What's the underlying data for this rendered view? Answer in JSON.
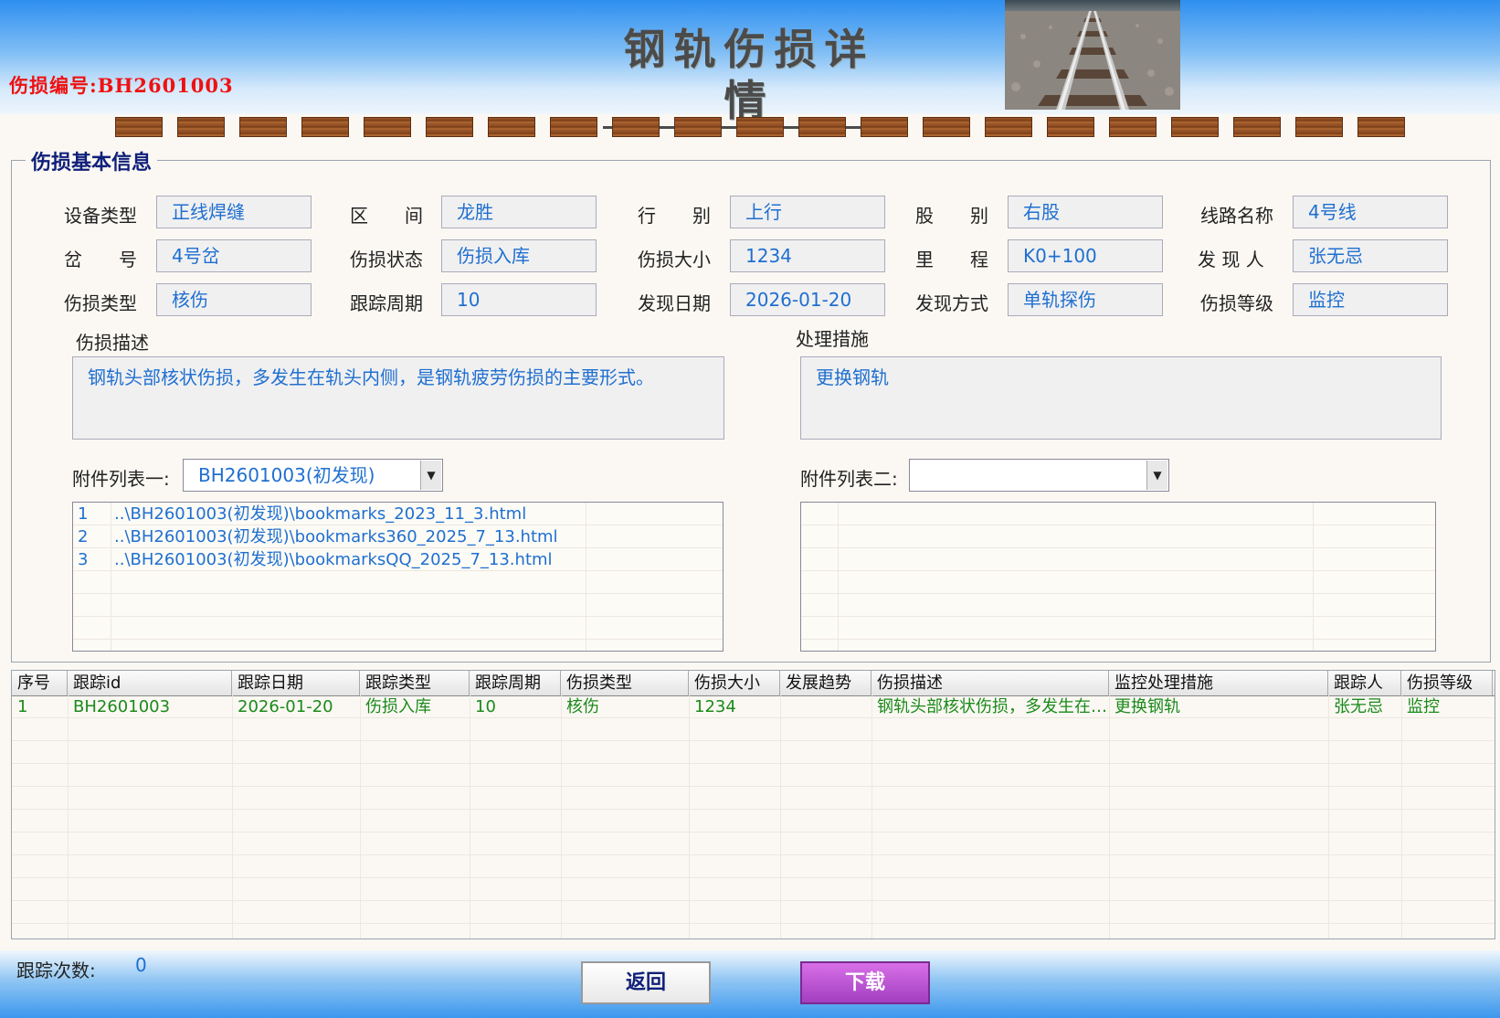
{
  "header": {
    "damage_no_label": "伤损编号:",
    "damage_no": "BH2601003",
    "title": "钢轨伤损详情"
  },
  "info": {
    "section_title": "伤损基本信息",
    "fields": [
      {
        "label": "设备类型",
        "value": "正线焊缝"
      },
      {
        "label": "区　　间",
        "value": "龙胜"
      },
      {
        "label": "行　　别",
        "value": "上行"
      },
      {
        "label": "股　　别",
        "value": "右股"
      },
      {
        "label": "线路名称",
        "value": "4号线"
      },
      {
        "label": "岔　　号",
        "value": "4号岔"
      },
      {
        "label": "伤损状态",
        "value": "伤损入库"
      },
      {
        "label": "伤损大小",
        "value": "1234"
      },
      {
        "label": "里　　程",
        "value": "K0+100"
      },
      {
        "label": "发 现 人",
        "value": "张无忌"
      },
      {
        "label": "伤损类型",
        "value": "核伤"
      },
      {
        "label": "跟踪周期",
        "value": "10"
      },
      {
        "label": "发现日期",
        "value": "2026-01-20"
      },
      {
        "label": "发现方式",
        "value": "单轨探伤"
      },
      {
        "label": "伤损等级",
        "value": "监控"
      }
    ],
    "description_label": "伤损描述",
    "description": "钢轨头部核状伤损，多发生在轨头内侧，是钢轨疲劳伤损的主要形式。",
    "measures_label": "处理措施",
    "measures": "更换钢轨"
  },
  "attachments": {
    "list1_label": "附件列表一:",
    "list1_selected": "BH2601003(初发现)",
    "list1_items": [
      {
        "no": "1",
        "path": "..\\BH2601003(初发现)\\bookmarks_2023_11_3.html"
      },
      {
        "no": "2",
        "path": "..\\BH2601003(初发现)\\bookmarks360_2025_7_13.html"
      },
      {
        "no": "3",
        "path": "..\\BH2601003(初发现)\\bookmarksQQ_2025_7_13.html"
      }
    ],
    "list2_label": "附件列表二:",
    "list2_selected": ""
  },
  "grid": {
    "columns": [
      "序号",
      "跟踪id",
      "跟踪日期",
      "跟踪类型",
      "跟踪周期",
      "伤损类型",
      "伤损大小",
      "发展趋势",
      "伤损描述",
      "监控处理措施",
      "跟踪人",
      "伤损等级"
    ],
    "rows": [
      [
        "1",
        "BH2601003",
        "2026-01-20",
        "伤损入库",
        "10",
        "核伤",
        "1234",
        "",
        "钢轨头部核状伤损，多发生在…",
        "更换钢轨",
        "张无忌",
        "监控"
      ]
    ]
  },
  "footer": {
    "count_label": "跟踪次数:",
    "count_value": "0",
    "back_label": "返回",
    "download_label": "下载"
  },
  "colors": {
    "value_text": "#1f6fd0",
    "grid_text": "#1a8a1a",
    "damage_no": "#ee1111",
    "section_title": "#10207a"
  },
  "icons": {
    "dropdown": "chevron-down-icon",
    "header_image": "railway-track-photo"
  }
}
